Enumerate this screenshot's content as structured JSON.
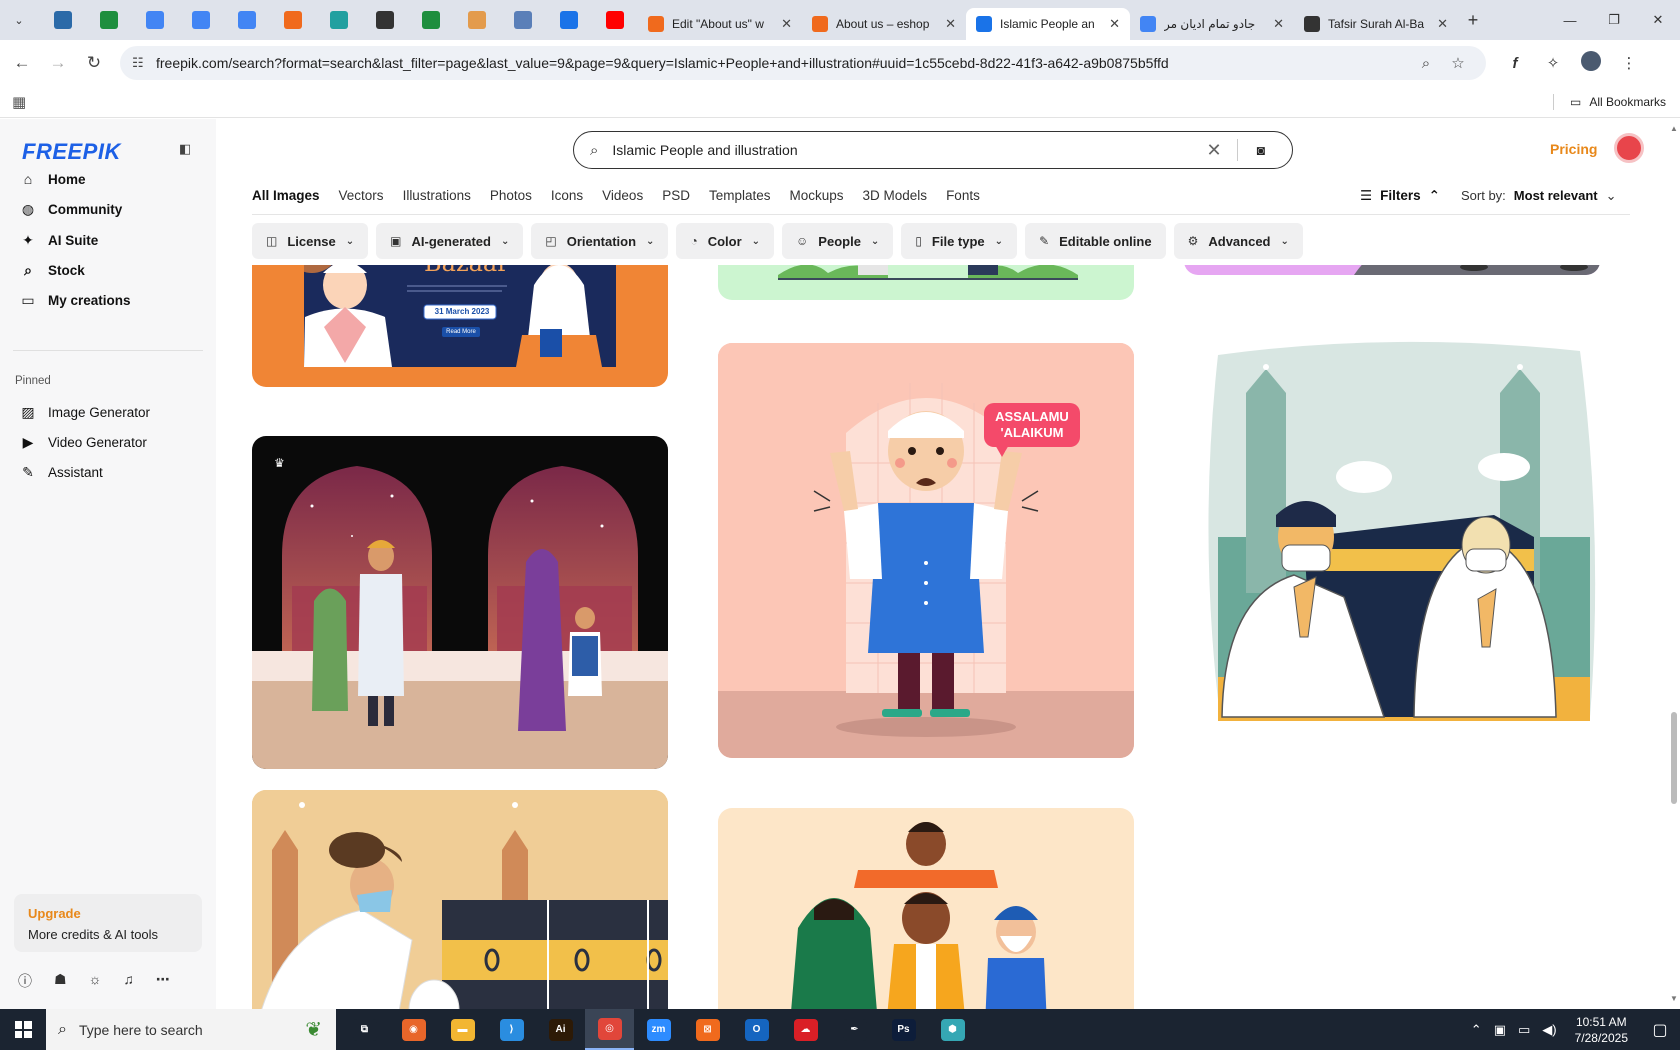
{
  "browser": {
    "pinned_tabs": [
      {
        "icon": "wordpress-icon",
        "color": "#2b6aa8"
      },
      {
        "icon": "sheets-icon",
        "color": "#1e8e3e"
      },
      {
        "icon": "docs-icon",
        "color": "#4285f4"
      },
      {
        "icon": "docs-icon",
        "color": "#4285f4"
      },
      {
        "icon": "docs-icon",
        "color": "#4285f4"
      },
      {
        "icon": "xampp-icon",
        "color": "#f06a1d"
      },
      {
        "icon": "app-icon",
        "color": "#21a0a0"
      },
      {
        "icon": "chatgpt-icon",
        "color": "#333333"
      },
      {
        "icon": "sheets-icon",
        "color": "#1e8e3e"
      },
      {
        "icon": "hand-icon",
        "color": "#e39b4c"
      },
      {
        "icon": "grid-icon",
        "color": "#5a7fb8"
      },
      {
        "icon": "forms-icon",
        "color": "#1a73e8"
      },
      {
        "icon": "youtube-icon",
        "color": "#ff0000"
      }
    ],
    "tabs": [
      {
        "title": "Edit \"About us\" w",
        "icon": "xampp-icon",
        "color": "#f06a1d",
        "active": false
      },
      {
        "title": "About us – eshop",
        "icon": "xampp-icon",
        "color": "#f06a1d",
        "active": false
      },
      {
        "title": "Islamic People an",
        "icon": "docs-icon",
        "color": "#1a73e8",
        "active": true
      },
      {
        "title": "جادو تمام ادیان مر",
        "icon": "google-icon",
        "color": "#4285f4",
        "active": false
      },
      {
        "title": "Tafsir Surah Al-Ba",
        "icon": "quran-icon",
        "color": "#333333",
        "active": false
      }
    ],
    "url": "freepik.com/search?format=search&last_filter=page&last_value=9&page=9&query=Islamic+People+and+illustration#uuid=1c55cebd-8d22-41f3-a642-a9b0875b5ffd",
    "all_bookmarks": "All Bookmarks"
  },
  "sidebar": {
    "logo": "FREEPIK",
    "nav": [
      {
        "label": "Home",
        "icon": "home-icon",
        "glyph": "⌂"
      },
      {
        "label": "Community",
        "icon": "globe-icon",
        "glyph": "◍"
      },
      {
        "label": "AI Suite",
        "icon": "sparkle-icon",
        "glyph": "✦"
      },
      {
        "label": "Stock",
        "icon": "search-icon",
        "glyph": "⌕"
      },
      {
        "label": "My creations",
        "icon": "folder-icon",
        "glyph": "▭"
      }
    ],
    "pinned_label": "Pinned",
    "pinned": [
      {
        "label": "Image Generator",
        "icon": "image-icon",
        "glyph": "▨"
      },
      {
        "label": "Video Generator",
        "icon": "video-icon",
        "glyph": "▶"
      },
      {
        "label": "Assistant",
        "icon": "chat-icon",
        "glyph": "✎"
      }
    ],
    "upgrade_title": "Upgrade",
    "upgrade_sub": "More credits & AI tools"
  },
  "header": {
    "search_value": "Islamic People and illustration",
    "pricing": "Pricing"
  },
  "type_tabs": [
    "All Images",
    "Vectors",
    "Illustrations",
    "Photos",
    "Icons",
    "Videos",
    "PSD",
    "Templates",
    "Mockups",
    "3D Models",
    "Fonts"
  ],
  "filters_label": "Filters",
  "sort_label": "Sort by:",
  "sort_value": "Most relevant",
  "chips": [
    {
      "label": "License",
      "glyph": "◫"
    },
    {
      "label": "AI-generated",
      "glyph": "▣"
    },
    {
      "label": "Orientation",
      "glyph": "◰"
    },
    {
      "label": "Color",
      "glyph": "◔"
    },
    {
      "label": "People",
      "glyph": "☺"
    },
    {
      "label": "File type",
      "glyph": "▯"
    },
    {
      "label": "Editable online",
      "glyph": "✎"
    },
    {
      "label": "Advanced",
      "glyph": "⚙"
    }
  ],
  "cards": {
    "bazaar_title": "Bazaar",
    "bazaar_date": "31 March 2023",
    "bazaar_button": "Read More",
    "greeting_line1": "ASSALAMU",
    "greeting_line2": "'ALAIKUM"
  },
  "taskbar": {
    "search_placeholder": "Type here to search",
    "apps": [
      {
        "name": "task-view-icon",
        "label": "⧉",
        "color": "#1b2431"
      },
      {
        "name": "firefox-icon",
        "label": "◉",
        "color": "#e8662a"
      },
      {
        "name": "explorer-icon",
        "label": "▬",
        "color": "#f2b632"
      },
      {
        "name": "vscode-icon",
        "label": "⟩",
        "color": "#2a8de0"
      },
      {
        "name": "illustrator-icon",
        "label": "Ai",
        "color": "#2d1a06"
      },
      {
        "name": "chrome-icon",
        "label": "◎",
        "color": "#e1463a"
      },
      {
        "name": "zoom-icon",
        "label": "zm",
        "color": "#2d8cff"
      },
      {
        "name": "xampp-icon",
        "label": "⊠",
        "color": "#f06a1d"
      },
      {
        "name": "outlook-icon",
        "label": "O",
        "color": "#1565c0"
      },
      {
        "name": "creative-cloud-icon",
        "label": "☁",
        "color": "#da1f26"
      },
      {
        "name": "pen-icon",
        "label": "✒",
        "color": "#1b2431"
      },
      {
        "name": "photoshop-icon",
        "label": "Ps",
        "color": "#0d1d3a"
      },
      {
        "name": "app-icon",
        "label": "⬢",
        "color": "#35a7b4"
      }
    ],
    "time": "10:51 AM",
    "date": "7/28/2025"
  }
}
